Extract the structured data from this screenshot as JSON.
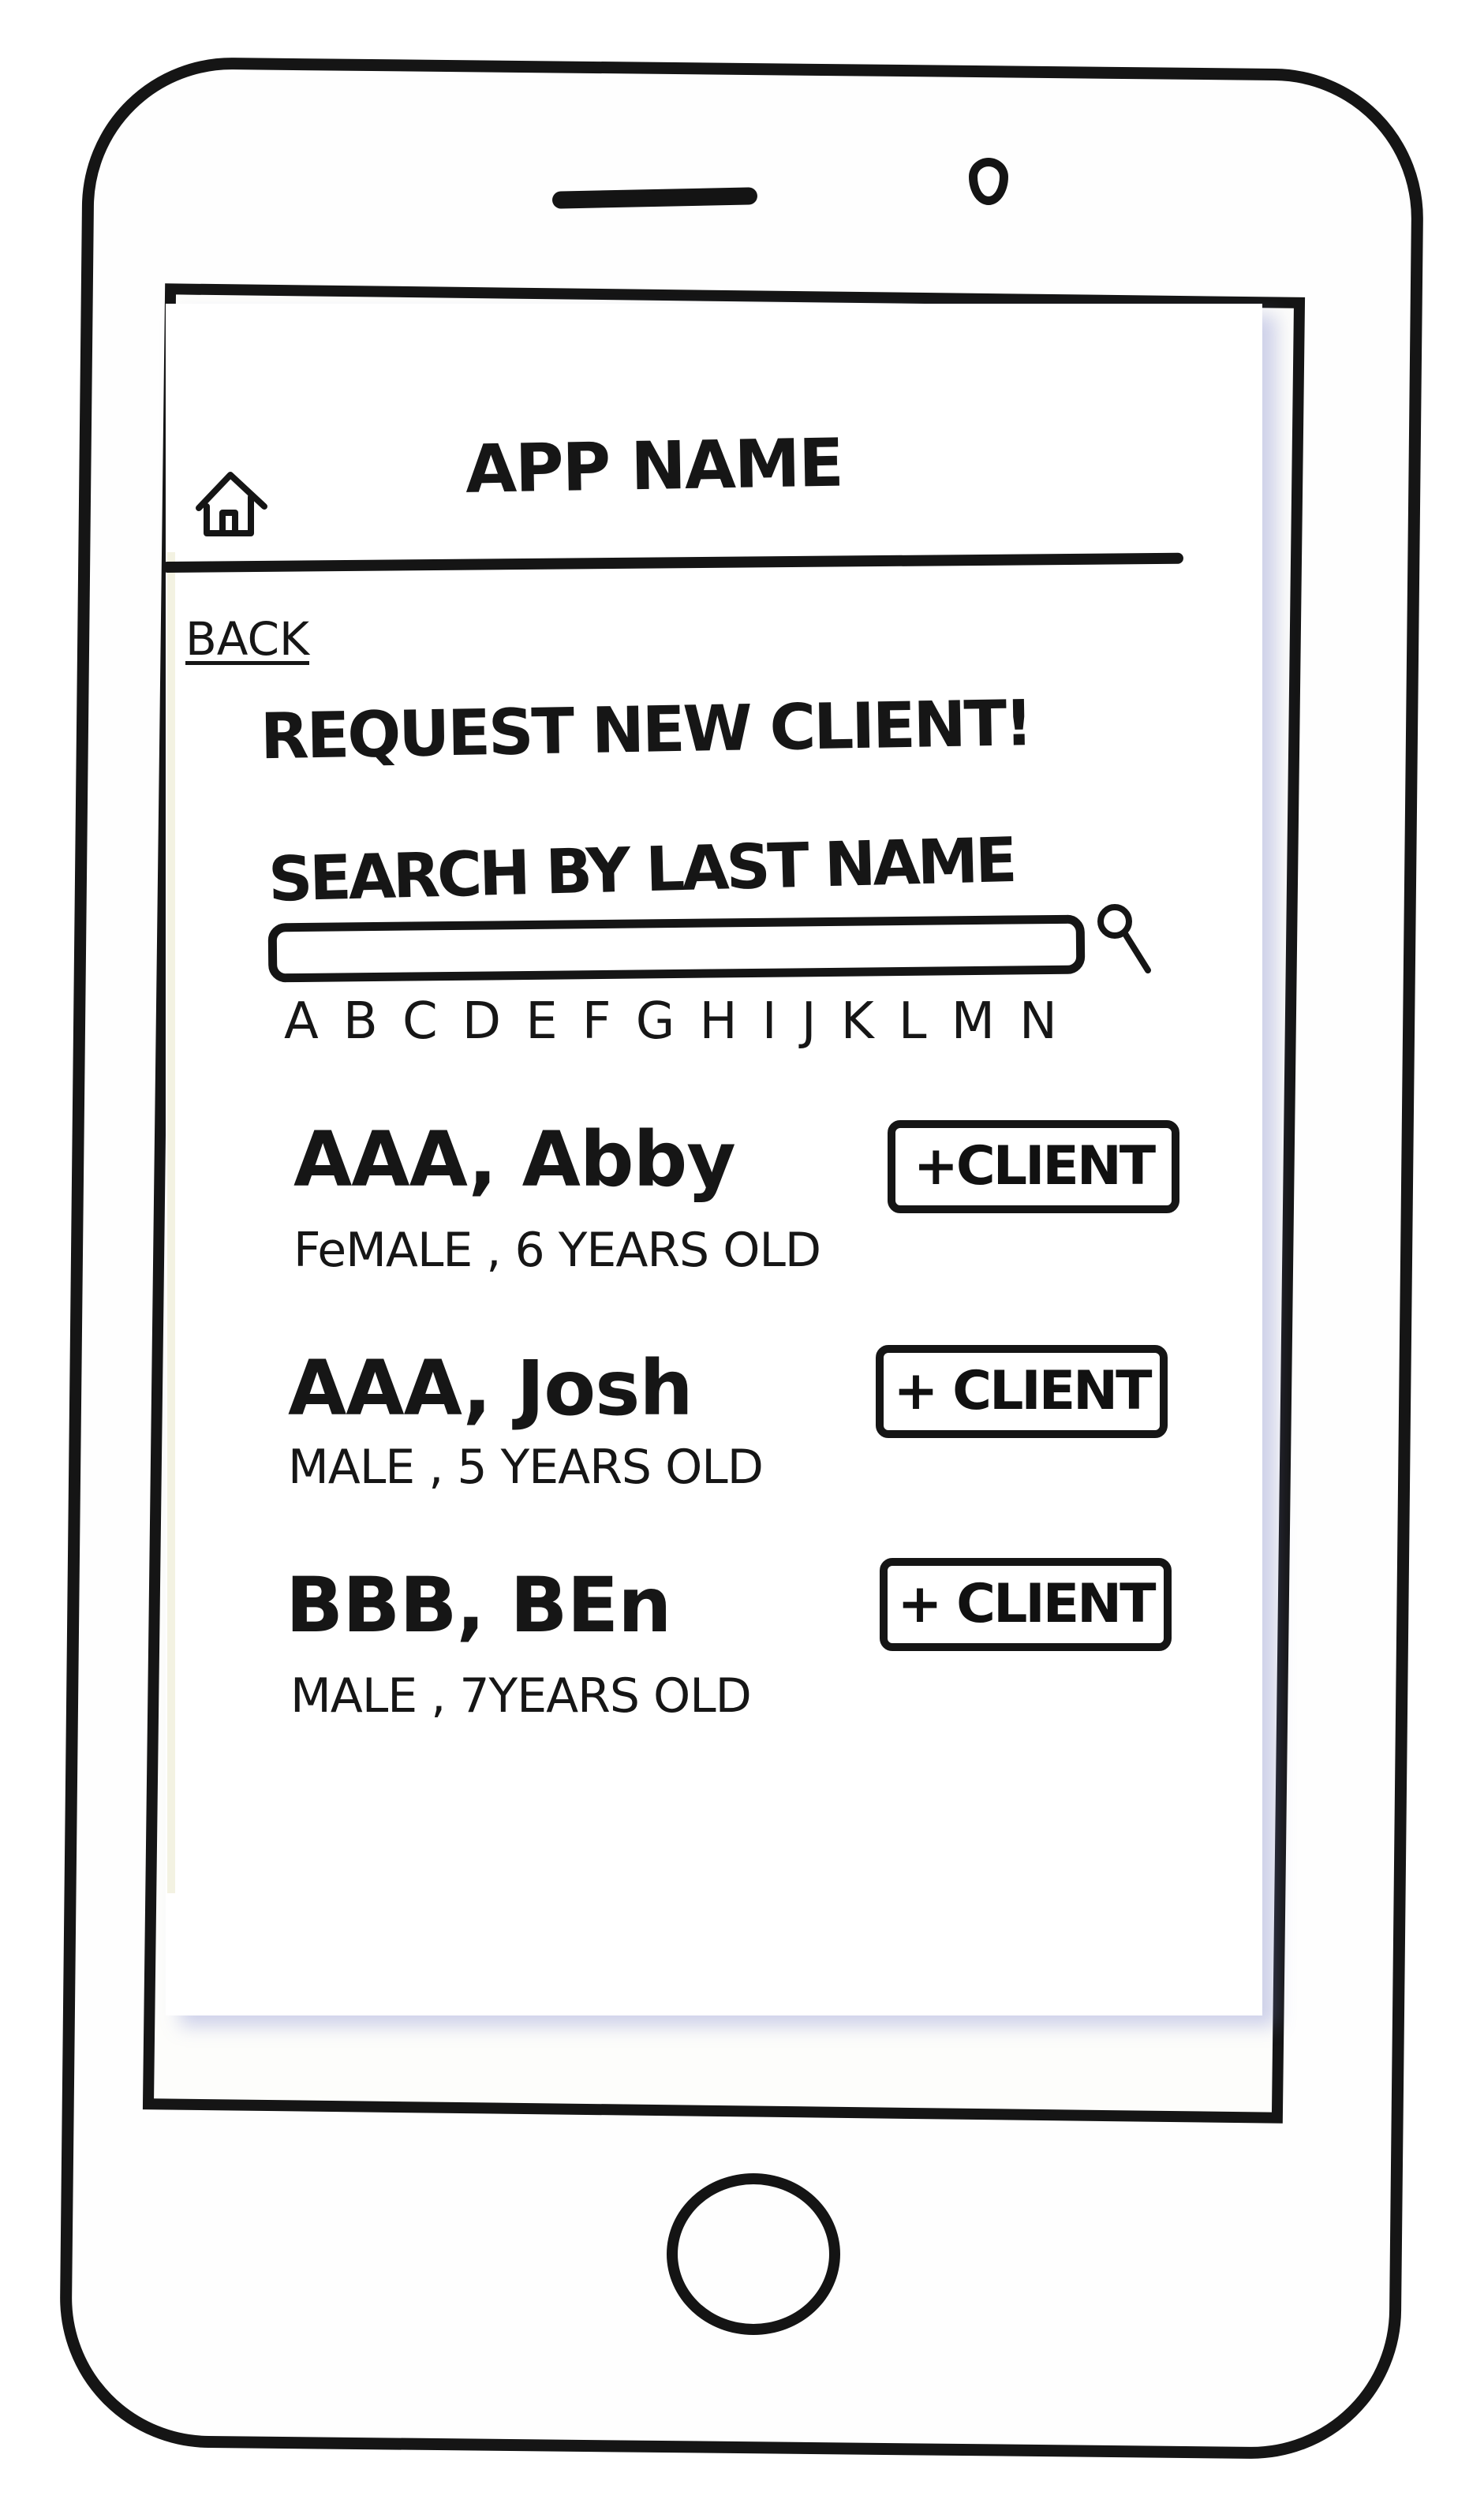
{
  "header": {
    "app_name": "APP NAME",
    "home_icon": "home-icon"
  },
  "nav": {
    "back_label": "BACK"
  },
  "page": {
    "title": "REQUEST NEW CLIENT!"
  },
  "search": {
    "label": "SEARCH BY LAST NAME",
    "value": "",
    "icon": "search-icon",
    "alphabet": [
      "A",
      "B",
      "C",
      "D",
      "E",
      "F",
      "G",
      "H",
      "I",
      "J",
      "K",
      "L",
      "M",
      "N"
    ]
  },
  "clients": [
    {
      "name": "AAA, Abby",
      "detail": "FeMALE , 6 YEARS OLD",
      "button_label": "+CLIENT"
    },
    {
      "name": "AAA, Josh",
      "detail": "MALE , 5 YEARS OLD",
      "button_label": "+ CLIENT"
    },
    {
      "name": "BBB, BEn",
      "detail": "MALE , 7YEARS OLD",
      "button_label": "+ CLIENT"
    }
  ]
}
